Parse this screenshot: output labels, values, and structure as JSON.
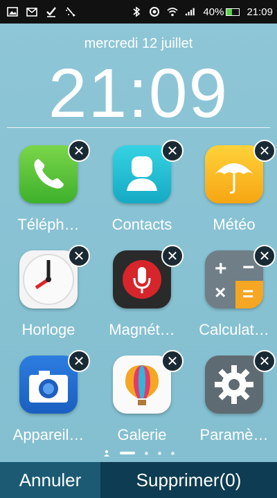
{
  "status_bar": {
    "left_icons": [
      "image-icon",
      "mail-icon",
      "check-icon",
      "broom-icon"
    ],
    "battery": "40%",
    "battery_level": 0.4,
    "time": "21:09"
  },
  "lockscreen": {
    "date": "mercredi 12 juillet",
    "time": "21:09"
  },
  "apps": [
    {
      "label": "Téléph…",
      "full": "Téléphone",
      "icon": "phone-icon"
    },
    {
      "label": "Contacts",
      "icon": "contacts-icon"
    },
    {
      "label": "Météo",
      "icon": "weather-icon"
    },
    {
      "label": "Horloge",
      "icon": "clock-icon"
    },
    {
      "label": "Magnét…",
      "icon": "recorder-icon"
    },
    {
      "label": "Calculat…",
      "icon": "calculator-icon"
    },
    {
      "label": "Appareil…",
      "icon": "camera-icon"
    },
    {
      "label": "Galerie",
      "icon": "gallery-icon"
    },
    {
      "label": "Paramè…",
      "icon": "settings-icon"
    }
  ],
  "delete_badge": "✕",
  "page_indicator": {
    "pages": 4,
    "active": 1
  },
  "buttons": {
    "cancel": "Annuler",
    "delete": "Supprimer(0)"
  }
}
